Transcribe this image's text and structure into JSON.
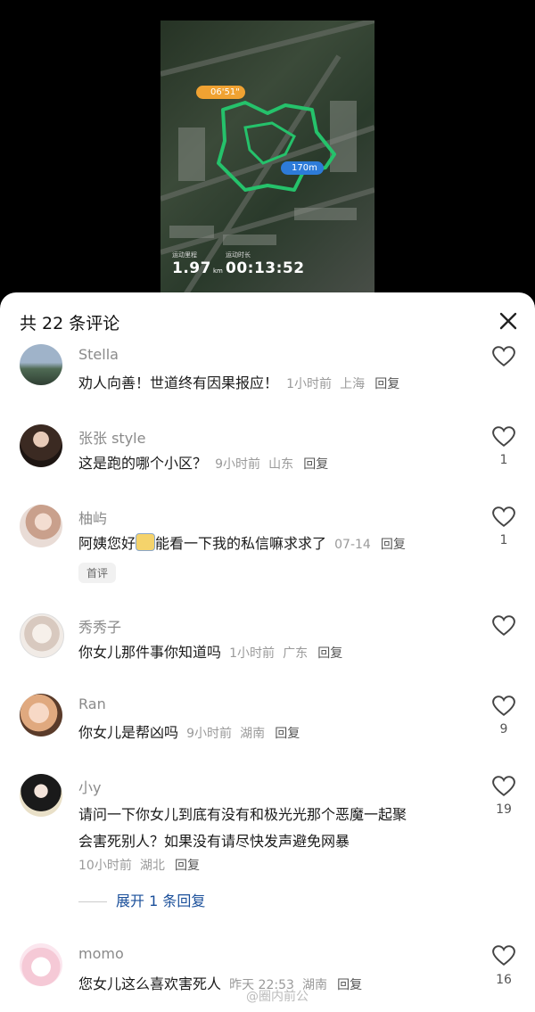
{
  "video": {
    "pace": "06'51\"",
    "distance_marker": "170m",
    "stats": [
      {
        "label": "运动里程",
        "value": "1.97",
        "unit": "km"
      },
      {
        "label": "运动时长",
        "value": "00:13:52",
        "unit": ""
      }
    ]
  },
  "sheet": {
    "title": "共 22 条评论",
    "close_icon": "close-icon"
  },
  "comments": [
    {
      "user": "Stella",
      "text": "劝人向善！世道终有因果报应！",
      "time": "1小时前",
      "location": "上海",
      "reply": "回复",
      "likes": ""
    },
    {
      "user": "张张 style",
      "text": "这是跑的哪个小区？",
      "time": "9小时前",
      "location": "山东",
      "reply": "回复",
      "likes": "1"
    },
    {
      "user": "柚屿",
      "text": "阿姨您好",
      "text2": "能看一下我的私信嘛求求了",
      "time": "07-14",
      "location": "",
      "reply": "回复",
      "likes": "1",
      "badge": "首评"
    },
    {
      "user": "秀秀子",
      "text": "你女儿那件事你知道吗",
      "time": "1小时前",
      "location": "广东",
      "reply": "回复",
      "likes": ""
    },
    {
      "user": "Ran",
      "text": "你女儿是帮凶吗",
      "time": "9小时前",
      "location": "湖南",
      "reply": "回复",
      "likes": "9"
    },
    {
      "user": "小y",
      "text": "请问一下你女儿到底有没有和极光光那个恶魔一起聚",
      "text_line2": "会害死别人？如果没有请尽快发声避免网暴",
      "time": "10小时前",
      "location": "湖北",
      "reply": "回复",
      "likes": "19",
      "expand": "展开 1 条回复"
    },
    {
      "user": "momo",
      "text": "您女儿这么喜欢害死人",
      "time": "昨天 22:53",
      "location": "湖南",
      "reply": "回复",
      "likes": "16"
    }
  ],
  "watermark": "@圈内前公"
}
